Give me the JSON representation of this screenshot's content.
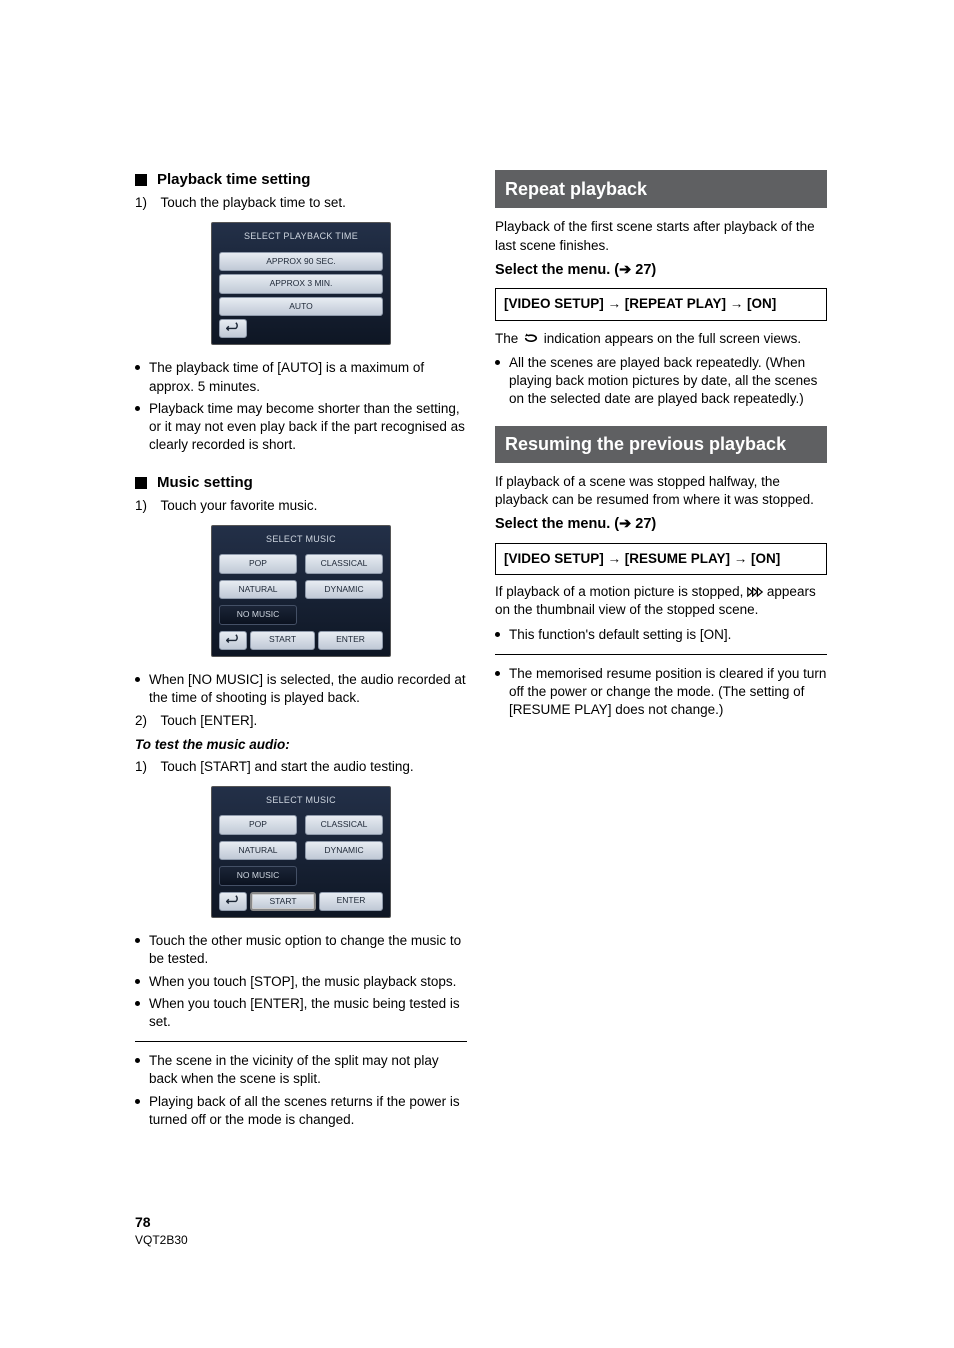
{
  "left": {
    "playback_time": {
      "heading": "Playback time setting",
      "step1_num": "1)",
      "step1_text": "Touch the playback time to set.",
      "osd": {
        "title": "SELECT PLAYBACK TIME",
        "opt1": "APPROX 90 SEC.",
        "opt2": "APPROX 3 MIN.",
        "opt3": "AUTO"
      },
      "bullets": [
        "The playback time of [AUTO] is a maximum of approx. 5 minutes.",
        "Playback time may become shorter than the setting, or it may not even play back if the part recognised as clearly recorded is short."
      ]
    },
    "music": {
      "heading": "Music setting",
      "step1_num": "1)",
      "step1_text": "Touch your favorite music.",
      "osd": {
        "title": "SELECT MUSIC",
        "pop": "POP",
        "classical": "CLASSICAL",
        "natural": "NATURAL",
        "dynamic": "DYNAMIC",
        "no_music": "NO MUSIC",
        "start": "START",
        "enter": "ENTER"
      },
      "bullet_no_music": "When [NO MUSIC] is selected, the audio recorded at the time of shooting is played back.",
      "step2_num": "2)",
      "step2_text": "Touch [ENTER].",
      "test_heading": "To test the music audio:",
      "test_step1_num": "1)",
      "test_step1_text": "Touch [START] and start the audio testing.",
      "test_bullets": [
        "Touch the other music option to change the music to be tested.",
        "When you touch [STOP], the music playback stops.",
        "When you touch [ENTER], the music being tested is set."
      ],
      "post_rule_bullets": [
        "The scene in the vicinity of the split may not play back when the scene is split.",
        "Playing back of all the scenes returns if the power is turned off or the mode is changed."
      ]
    }
  },
  "right": {
    "repeat": {
      "title": "Repeat playback",
      "intro": "Playback of the first scene starts after playback of the last scene finishes.",
      "select_menu": "Select the menu. (➔ 27)",
      "menu_box": "[VIDEO SETUP] → [REPEAT PLAY] → [ON]",
      "the_text_a": "The ",
      "the_text_b": " indication appears on the full screen views.",
      "bullets": [
        "All the scenes are played back repeatedly. (When playing back motion pictures by date, all the scenes on the selected date are played back repeatedly.)"
      ]
    },
    "resume": {
      "title": "Resuming the previous playback",
      "intro": "If playback of a scene was stopped halfway, the playback can be resumed from where it was stopped.",
      "select_menu": "Select the menu. (➔ 27)",
      "menu_box": "[VIDEO SETUP] → [RESUME PLAY] → [ON]",
      "stopped_a": "If playback of a motion picture is stopped, ",
      "stopped_b": " appears on the thumbnail view of the stopped scene.",
      "bullets1": [
        "This function's default setting is [ON]."
      ],
      "bullets2": [
        "The memorised resume position is cleared if you turn off the power or change the mode. (The setting of [RESUME PLAY] does not change.)"
      ]
    }
  },
  "footer": {
    "page": "78",
    "code": "VQT2B30"
  }
}
